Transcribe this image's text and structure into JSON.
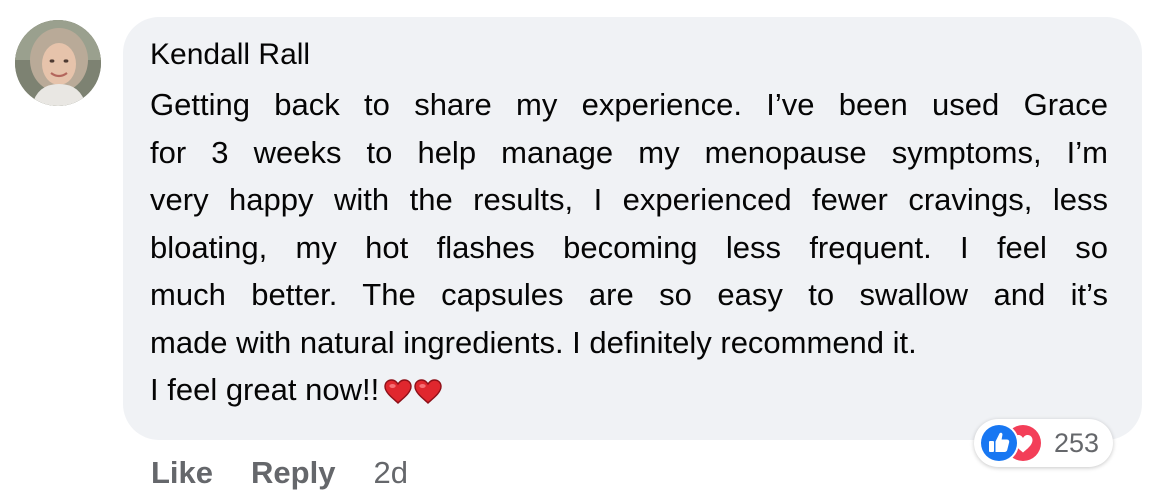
{
  "comment": {
    "author": "Kendall Rall",
    "lines": [
      "Getting back to share my experience. I’ve been used Grace",
      "for 3 weeks to help manage my menopause symptoms, I’m",
      "very happy with the results, I experienced fewer cravings, less",
      "bloating, my hot flashes becoming less frequent. I feel so",
      "much better. The capsules are so easy to swallow and it’s",
      "made with natural ingredients. I definitely recommend it.",
      "I feel great now!!"
    ],
    "trailing_emoji": "heart-emoji x2"
  },
  "reactions": {
    "types": [
      "like",
      "love"
    ],
    "count": "253",
    "like_color": "#1877f2",
    "love_color": "#f33e58"
  },
  "actions": {
    "like_label": "Like",
    "reply_label": "Reply",
    "timestamp": "2d"
  },
  "colors": {
    "bubble_background": "#f0f2f5",
    "primary_text": "#050505",
    "secondary_text": "#65676b"
  }
}
